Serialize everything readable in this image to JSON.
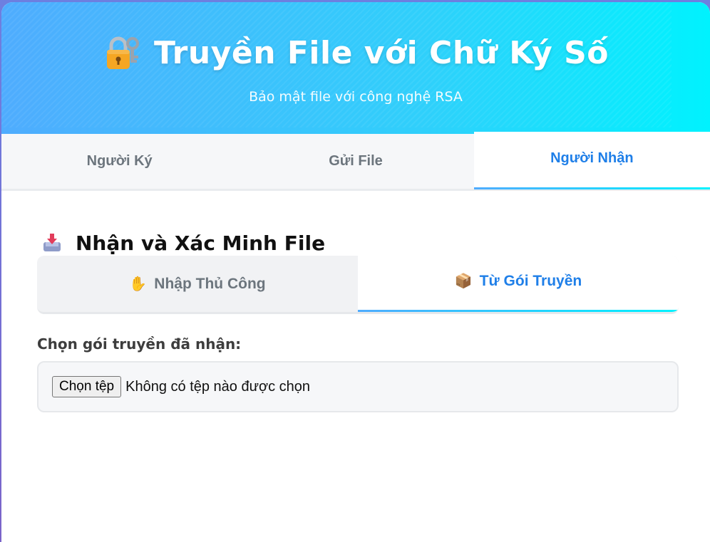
{
  "header": {
    "title": "Truyền File với Chữ Ký Số",
    "subtitle": "Bảo mật file với công nghệ RSA",
    "icon": "lock-with-key-icon"
  },
  "main_tabs": [
    {
      "label": "Người Ký",
      "active": false
    },
    {
      "label": "Gửi File",
      "active": false
    },
    {
      "label": "Người Nhận",
      "active": true
    }
  ],
  "section": {
    "title": "Nhận và Xác Minh File",
    "icon": "inbox-tray-icon"
  },
  "sub_tabs": [
    {
      "emoji": "✋",
      "label": "Nhập Thủ Công",
      "active": false
    },
    {
      "emoji": "📦",
      "label": "Từ Gói Truyền",
      "active": true
    }
  ],
  "file_field": {
    "label": "Chọn gói truyền đã nhận:",
    "button_label": "Chọn tệp",
    "status": "Không có tệp nào được chọn"
  },
  "colors": {
    "accent": "#1f7fe8",
    "header_start": "#4facfe",
    "header_end": "#00f2fe",
    "tab_inactive": "#6c757d"
  }
}
